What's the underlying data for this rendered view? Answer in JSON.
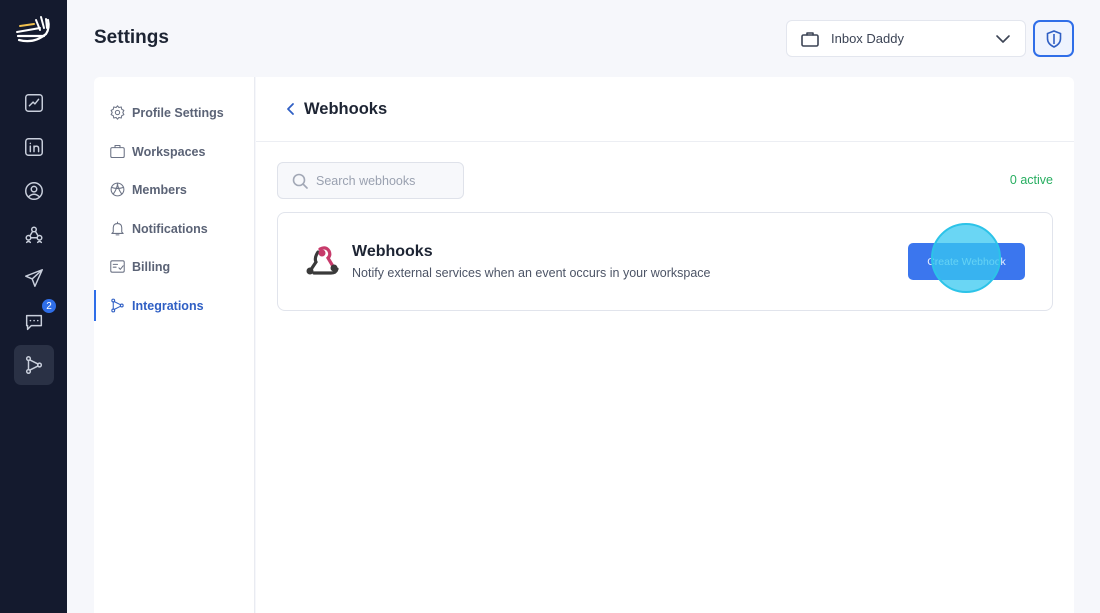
{
  "header": {
    "title": "Settings",
    "workspace_selected": "Inbox Daddy"
  },
  "rail": {
    "items": [
      {
        "icon": "analytics-icon"
      },
      {
        "icon": "linkedin-icon"
      },
      {
        "icon": "user-circle-icon"
      },
      {
        "icon": "network-icon"
      },
      {
        "icon": "send-icon"
      },
      {
        "icon": "chat-icon",
        "badge": "2"
      },
      {
        "icon": "integrations-icon",
        "active": true
      }
    ]
  },
  "settings_nav": {
    "items": [
      {
        "label": "Profile Settings",
        "icon": "gear-icon"
      },
      {
        "label": "Workspaces",
        "icon": "briefcase-icon"
      },
      {
        "label": "Members",
        "icon": "members-icon"
      },
      {
        "label": "Notifications",
        "icon": "bell-icon"
      },
      {
        "label": "Billing",
        "icon": "billing-icon"
      },
      {
        "label": "Integrations",
        "icon": "integrations-icon",
        "active": true
      }
    ]
  },
  "main": {
    "title": "Webhooks",
    "search_placeholder": "Search webhooks",
    "active_count": "0 active",
    "card": {
      "title": "Webhooks",
      "description": "Notify external services when an event occurs in your workspace",
      "button": "Create Webhook"
    }
  },
  "colors": {
    "accent": "#2f6ee8",
    "rail_bg": "#141a2e",
    "success": "#27ae60"
  }
}
